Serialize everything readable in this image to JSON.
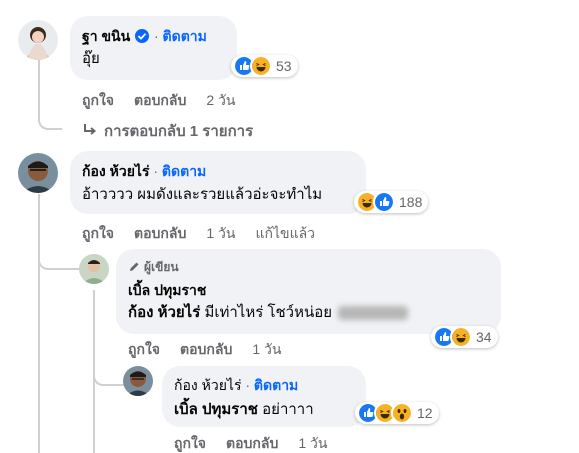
{
  "comments": [
    {
      "author": "ฐา ขนิน",
      "follow": "ติดตาม",
      "text": "อุ๊ย",
      "reaction_count": "53",
      "like": "ถูกใจ",
      "reply": "ตอบกลับ",
      "time": "2 วัน",
      "replies_link": "การตอบกลับ 1 รายการ"
    },
    {
      "author": "ก้อง ห้วยไร่",
      "follow": "ติดตาม",
      "text": "อ้าวววว ผมดังและรวยแล้วอ่ะจะทำไม",
      "reaction_count": "188",
      "like": "ถูกใจ",
      "reply": "ตอบกลับ",
      "time": "1 วัน",
      "edited": "แก้ไขแล้ว"
    },
    {
      "badge": "ผู้เขียน",
      "author": "เบิ้ล ปทุมราช",
      "mention": "ก้อง ห้วยไร่",
      "text": "มีเท่าไหร่ โชว์หน่อย",
      "reaction_count": "34",
      "like": "ถูกใจ",
      "reply": "ตอบกลับ",
      "time": "1 วัน"
    },
    {
      "author": "ก้อง ห้วยไร่",
      "follow": "ติดตาม",
      "mention": "เบิ้ล ปทุมราช",
      "text": "อย่าาาา",
      "reaction_count": "12",
      "like": "ถูกใจ",
      "reply": "ตอบกลับ",
      "time": "1 วัน"
    }
  ],
  "colors": {
    "bubble": "#f0f2f5",
    "link_blue": "#0866ff",
    "meta_gray": "#65676b",
    "like_blue": "#1877f2",
    "haha_yellow": "#f7b125"
  },
  "icons": [
    "verified-badge-icon",
    "like-reaction-icon",
    "haha-reaction-icon",
    "wow-reaction-icon",
    "reply-arrow-icon",
    "pencil-icon"
  ]
}
